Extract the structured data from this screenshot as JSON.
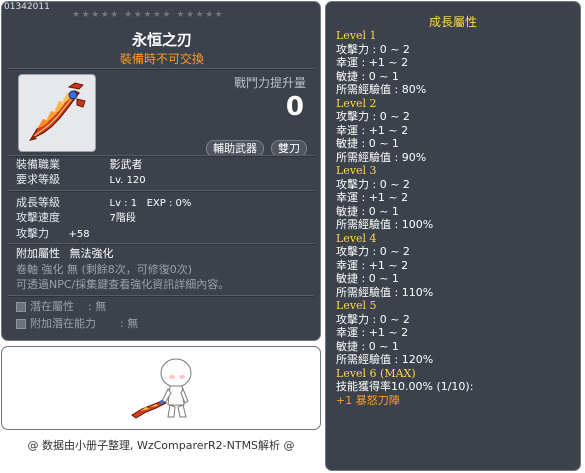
{
  "item": {
    "id": "01342011",
    "stars": "★★★★★ ★★★★★ ★★★★★",
    "name": "永恒之刃",
    "trade_note": "裝備時不可交換",
    "icon": "flame-blade-icon",
    "power_label": "戰鬥力提升量",
    "power_value": "0",
    "tags": [
      "輔助武器",
      "雙刀"
    ],
    "job_label": "裝備職業",
    "job_value": "影武者",
    "req_label": "要求等級",
    "req_value": "Lv. 120",
    "growth_label": "成長等級",
    "growth_value": "Lv : 1   EXP : 0%",
    "speed_label": "攻擊速度",
    "speed_value": "7階段",
    "atk_label": "攻擊力",
    "atk_value": "+58",
    "extra_label": "附加屬性",
    "extra_value": "無法強化",
    "scroll_line": "卷軸 強化 無 (剩餘8次，可修復0次)",
    "npc_line": "可透過NPC/採集鍵查看強化資訊詳細內容。",
    "potential_label": "潛在屬性",
    "potential_value": ": 無",
    "add_potential_label": "附加潛在能力",
    "add_potential_value": ": 無"
  },
  "footer": "@ 数据由小册子整理, WzComparerR2-NTMS解析 @",
  "growth": {
    "title": "成長屬性",
    "levels": [
      {
        "header": "Level 1",
        "lines": [
          "攻擊力 : 0 ~ 2",
          "幸運 : +1 ~ 2",
          "敏捷 : 0 ~ 1",
          "所需經驗值 : 80%"
        ]
      },
      {
        "header": "Level 2",
        "lines": [
          "攻擊力 : 0 ~ 2",
          "幸運 : +1 ~ 2",
          "敏捷 : 0 ~ 1",
          "所需經驗值 : 90%"
        ]
      },
      {
        "header": "Level 3",
        "lines": [
          "攻擊力 : 0 ~ 2",
          "幸運 : +1 ~ 2",
          "敏捷 : 0 ~ 1",
          "所需經驗值 : 100%"
        ]
      },
      {
        "header": "Level 4",
        "lines": [
          "攻擊力 : 0 ~ 2",
          "幸運 : +1 ~ 2",
          "敏捷 : 0 ~ 1",
          "所需經驗值 : 110%"
        ]
      },
      {
        "header": "Level 5",
        "lines": [
          "攻擊力 : 0 ~ 2",
          "幸運 : +1 ~ 2",
          "敏捷 : 0 ~ 1",
          "所需經驗值 : 120%"
        ]
      }
    ],
    "final_header": "Level 6 (MAX)",
    "skill_rate": "技能獲得率10.00% (1/10):",
    "skill_name": "+1 暴怒刀陣"
  },
  "colors": {
    "panel_bg": "#3b424b",
    "gold": "#ffd74a",
    "orange": "#ff9b26"
  }
}
